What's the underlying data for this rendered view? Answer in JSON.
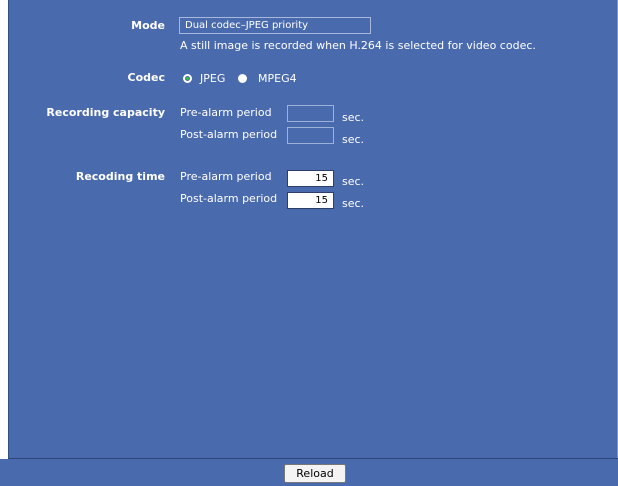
{
  "mode": {
    "label": "Mode",
    "value": "Dual codec–JPEG priority",
    "note": "A still image is recorded when H.264 is selected for video codec."
  },
  "codec": {
    "label": "Codec",
    "options": [
      "JPEG",
      "MPEG4"
    ],
    "selected": "JPEG"
  },
  "recording_capacity": {
    "label": "Recording capacity",
    "pre_label": "Pre-alarm period",
    "pre_value": "",
    "pre_unit": "sec.",
    "post_label": "Post-alarm period",
    "post_value": "",
    "post_unit": "sec."
  },
  "recording_time": {
    "label": "Recoding time",
    "pre_label": "Pre-alarm period",
    "pre_value": "15",
    "pre_unit": "sec.",
    "post_label": "Post-alarm period",
    "post_value": "15",
    "post_unit": "sec."
  },
  "footer": {
    "reload_label": "Reload"
  },
  "colors": {
    "panel_bg": "#4a6aae",
    "radio_selected": "#2fc43b"
  }
}
